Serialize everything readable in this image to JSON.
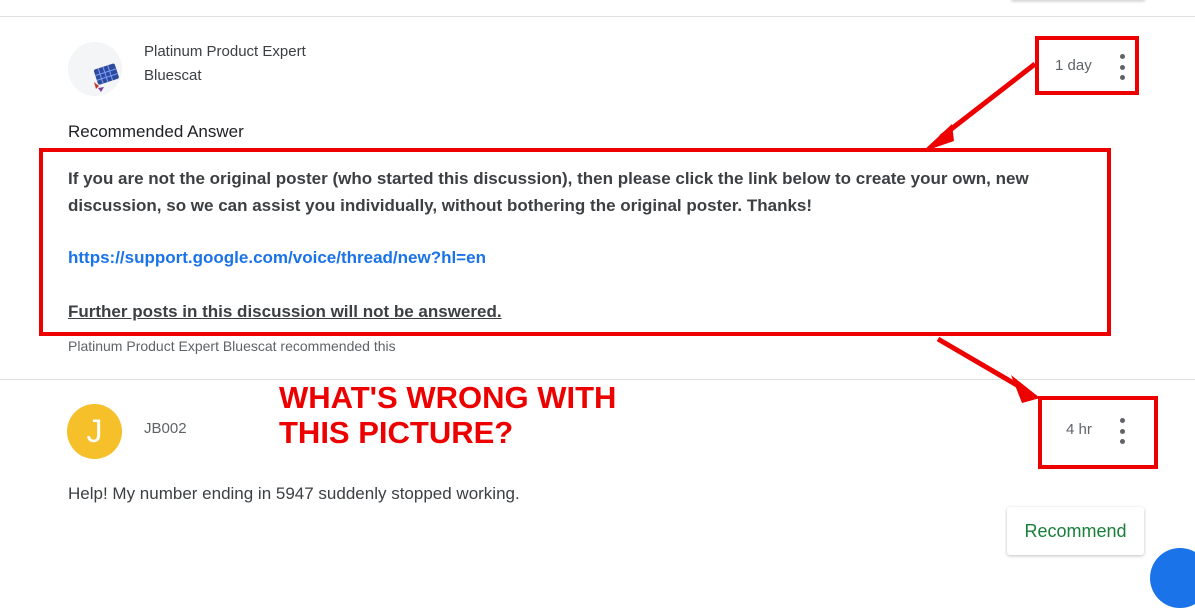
{
  "post_expert": {
    "badge": "Platinum Product Expert",
    "author": "Bluescat",
    "time": "1 day",
    "recommended_label": "Recommended Answer",
    "answer_line1": "If you are not the original poster (who started this discussion), then please click the link below to create your own, new",
    "answer_line2": "discussion, so we can assist you individually, without bothering the original poster.  Thanks!",
    "link": "https://support.google.com/voice/thread/new?hl=en",
    "warning": "Further posts in this discussion will not be answered.",
    "recommended_by": "Platinum Product Expert Bluescat recommended this"
  },
  "post_reply": {
    "avatar_letter": "J",
    "author": "JB002",
    "time": "4 hr",
    "body": "Help! My number ending in 5947 suddenly stopped working.",
    "recommend_label": "Recommend"
  },
  "annotation": {
    "text": "WHAT'S WRONG WITH\nTHIS PICTURE?",
    "color": "#ec0000"
  },
  "colors": {
    "link": "#1a73e8",
    "recommend_green": "#188038",
    "avatar_yellow": "#f6c02a"
  }
}
